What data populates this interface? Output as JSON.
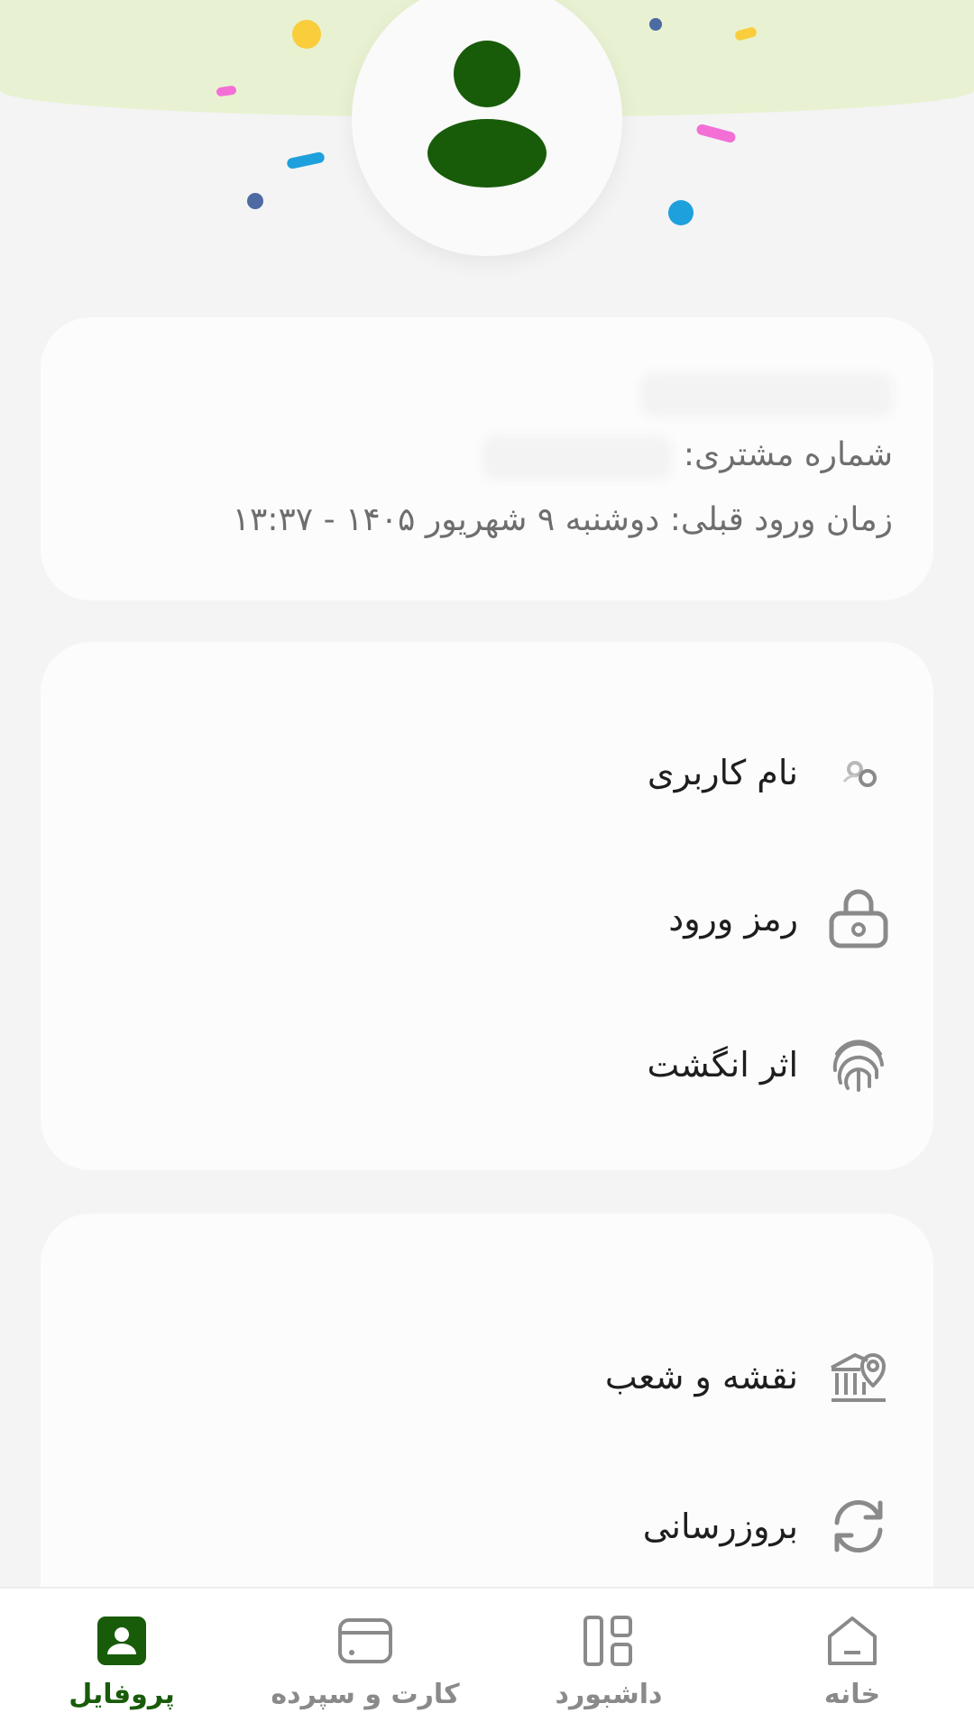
{
  "profile": {
    "customer_number_label": "شماره مشتری:",
    "last_login_text": "زمان ورود قبلی: دوشنبه ۹ شهریور ۱۴۰۵ - ۱۳:۳۷"
  },
  "settings": {
    "items": [
      {
        "label": "نام کاربری",
        "icon": "user-edit-icon"
      },
      {
        "label": "رمز ورود",
        "icon": "lock-icon"
      },
      {
        "label": "اثر انگشت",
        "icon": "fingerprint-icon"
      }
    ]
  },
  "more": {
    "items": [
      {
        "label": "نقشه و شعب",
        "icon": "bank-location-icon"
      },
      {
        "label": "بروزرسانی",
        "icon": "refresh-icon"
      }
    ]
  },
  "bottom_nav": {
    "items": [
      {
        "label": "پروفایل",
        "icon": "profile-icon",
        "active": true
      },
      {
        "label": "کارت و سپرده",
        "icon": "card-icon",
        "active": false
      },
      {
        "label": "داشبورد",
        "icon": "dashboard-icon",
        "active": false
      },
      {
        "label": "خانه",
        "icon": "home-icon",
        "active": false
      }
    ]
  },
  "colors": {
    "accent": "#185c0a",
    "header_band": "#e8f2d2",
    "background": "#f4f4f4",
    "icon_gray": "#8a8a8a"
  }
}
